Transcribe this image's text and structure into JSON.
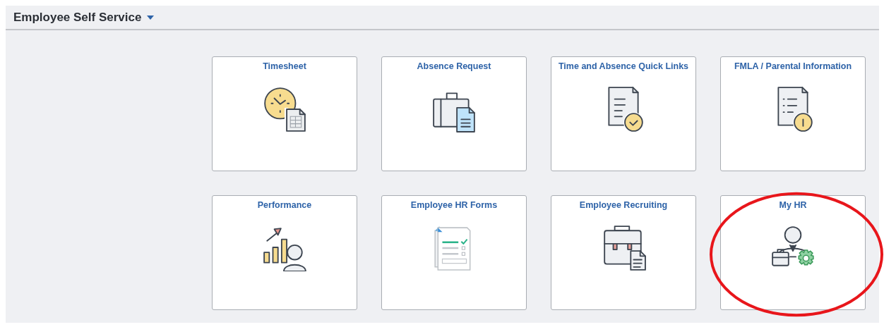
{
  "header": {
    "title": "Employee Self Service"
  },
  "tiles": [
    {
      "title": "Timesheet",
      "highlighted": false
    },
    {
      "title": "Absence Request",
      "highlighted": false
    },
    {
      "title": "Time and Absence Quick Links",
      "highlighted": false
    },
    {
      "title": "FMLA / Parental Information",
      "highlighted": false
    },
    {
      "title": "Performance",
      "highlighted": false
    },
    {
      "title": "Employee HR Forms",
      "highlighted": false
    },
    {
      "title": "Employee Recruiting",
      "highlighted": false
    },
    {
      "title": "My HR",
      "highlighted": true
    }
  ]
}
